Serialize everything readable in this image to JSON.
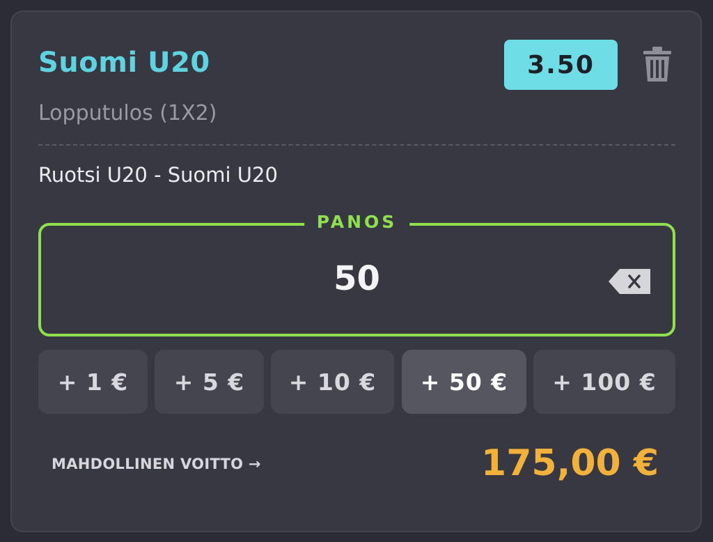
{
  "selection": {
    "team": "Suomi U20",
    "odds": "3.50",
    "market": "Lopputulos (1X2)",
    "match": "Ruotsi U20 - Suomi U20"
  },
  "stake": {
    "label": "PANOS",
    "value": "50"
  },
  "quick_stakes": [
    {
      "label": "+ 1 €"
    },
    {
      "label": "+ 5 €"
    },
    {
      "label": "+ 10 €"
    },
    {
      "label": "+ 50 €",
      "active": true
    },
    {
      "label": "+ 100 €"
    }
  ],
  "payout": {
    "label": "MAHDOLLINEN VOITTO →",
    "value": "175,00 €"
  },
  "icons": {
    "delete": "trash-icon",
    "clear": "backspace-icon"
  },
  "colors": {
    "accent_teal": "#5fd3df",
    "odds_bg": "#6fdde6",
    "stake_border": "#8ee04f",
    "payout": "#f1b13a",
    "card_bg": "#383842"
  }
}
